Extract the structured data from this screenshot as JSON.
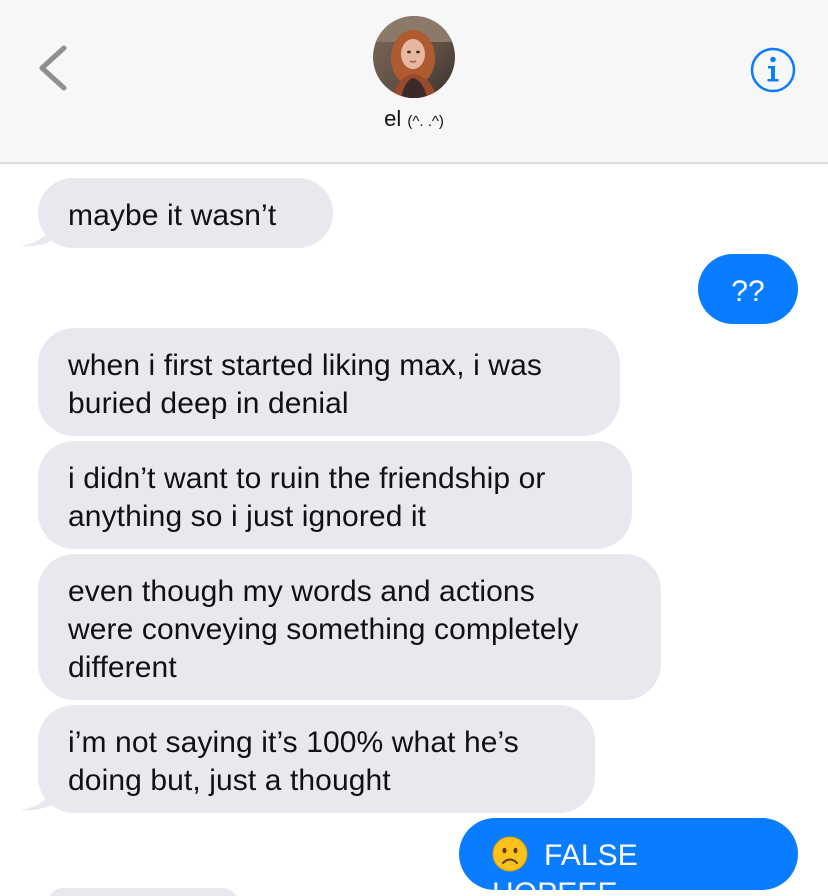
{
  "header": {
    "contact_name": "el",
    "contact_emoticon": "(^. .^)",
    "back_icon": "chevron-left-icon",
    "info_icon": "info-circle-icon"
  },
  "colors": {
    "incoming_bubble": "#e9e8ee",
    "outgoing_bubble": "#0a7cff",
    "accent": "#0a7cff"
  },
  "messages": [
    {
      "direction": "incoming",
      "text": "maybe it wasn’t"
    },
    {
      "direction": "outgoing",
      "text": "??"
    },
    {
      "direction": "incoming",
      "lines": [
        "when i first started liking max, i was",
        "buried deep in denial"
      ]
    },
    {
      "direction": "incoming",
      "lines": [
        "i didn’t want to ruin the friendship or",
        "anything so i just ignored it"
      ]
    },
    {
      "direction": "incoming",
      "lines": [
        "even though my words and actions",
        "were conveying something completely",
        "different"
      ]
    },
    {
      "direction": "incoming",
      "lines": [
        "i’m not saying it’s 100% what he’s",
        "doing but, just a thought"
      ]
    },
    {
      "direction": "outgoing",
      "emoji": "frowning-face-emoji",
      "text": "FALSE HOPEEE"
    }
  ]
}
